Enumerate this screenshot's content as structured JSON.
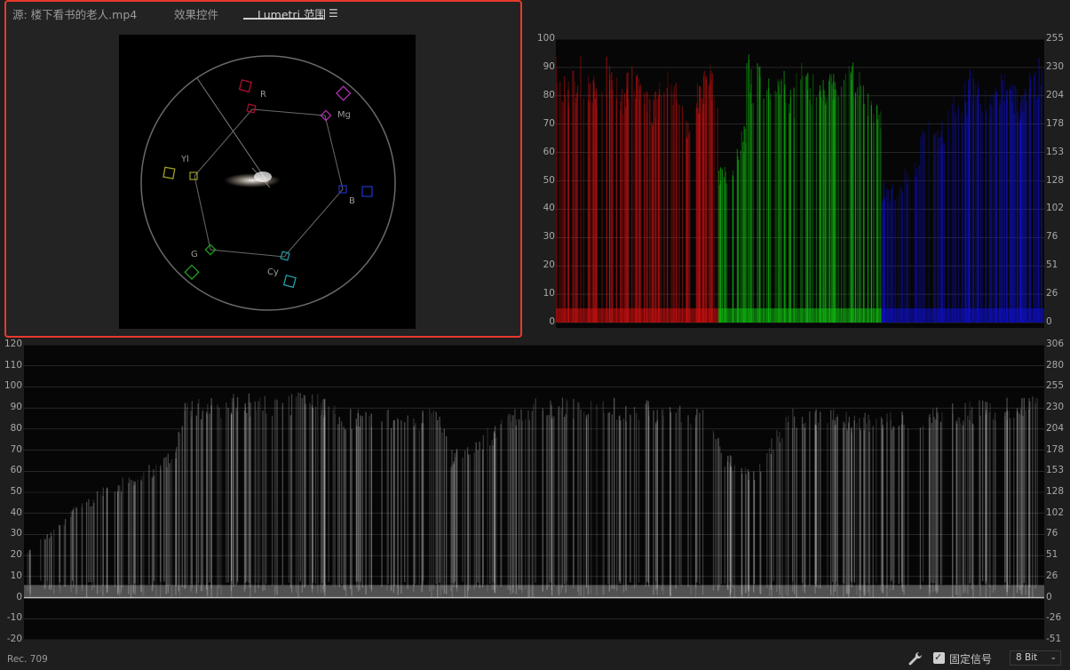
{
  "tabs": [
    {
      "label": "源: 楼下看书的老人.mp4",
      "active": false
    },
    {
      "label": "效果控件",
      "active": false
    },
    {
      "label": "Lumetri 范围",
      "active": true
    }
  ],
  "menu_icon": "hamburger-icon",
  "vectorscope": {
    "targets": [
      {
        "label": "R",
        "color": "#b01030"
      },
      {
        "label": "Mg",
        "color": "#b030b0"
      },
      {
        "label": "B",
        "color": "#2030c0"
      },
      {
        "label": "Cy",
        "color": "#20a0b0"
      },
      {
        "label": "G",
        "color": "#20a020"
      },
      {
        "label": "Yl",
        "color": "#a0a020"
      }
    ]
  },
  "parade": {
    "left_scale": [
      "100",
      "90",
      "80",
      "70",
      "60",
      "50",
      "40",
      "30",
      "20",
      "10",
      "0"
    ],
    "right_scale": [
      "255",
      "230",
      "204",
      "178",
      "153",
      "128",
      "102",
      "76",
      "51",
      "26",
      "0"
    ],
    "channel_colors": [
      "#d01010",
      "#10c010",
      "#1010d0"
    ]
  },
  "waveform": {
    "left_scale": [
      "120",
      "110",
      "100",
      "90",
      "80",
      "70",
      "60",
      "50",
      "40",
      "30",
      "20",
      "10",
      "0",
      "-10",
      "-20"
    ],
    "right_scale": [
      "306",
      "280",
      "255",
      "230",
      "204",
      "178",
      "153",
      "128",
      "102",
      "76",
      "51",
      "26",
      "0",
      "-26",
      "-51"
    ]
  },
  "footer": {
    "standard": "Rec. 709",
    "wrench_icon": "wrench-icon",
    "clamp_label": "固定信号",
    "clamp_checked": true,
    "bitdepth": "8 Bit"
  }
}
